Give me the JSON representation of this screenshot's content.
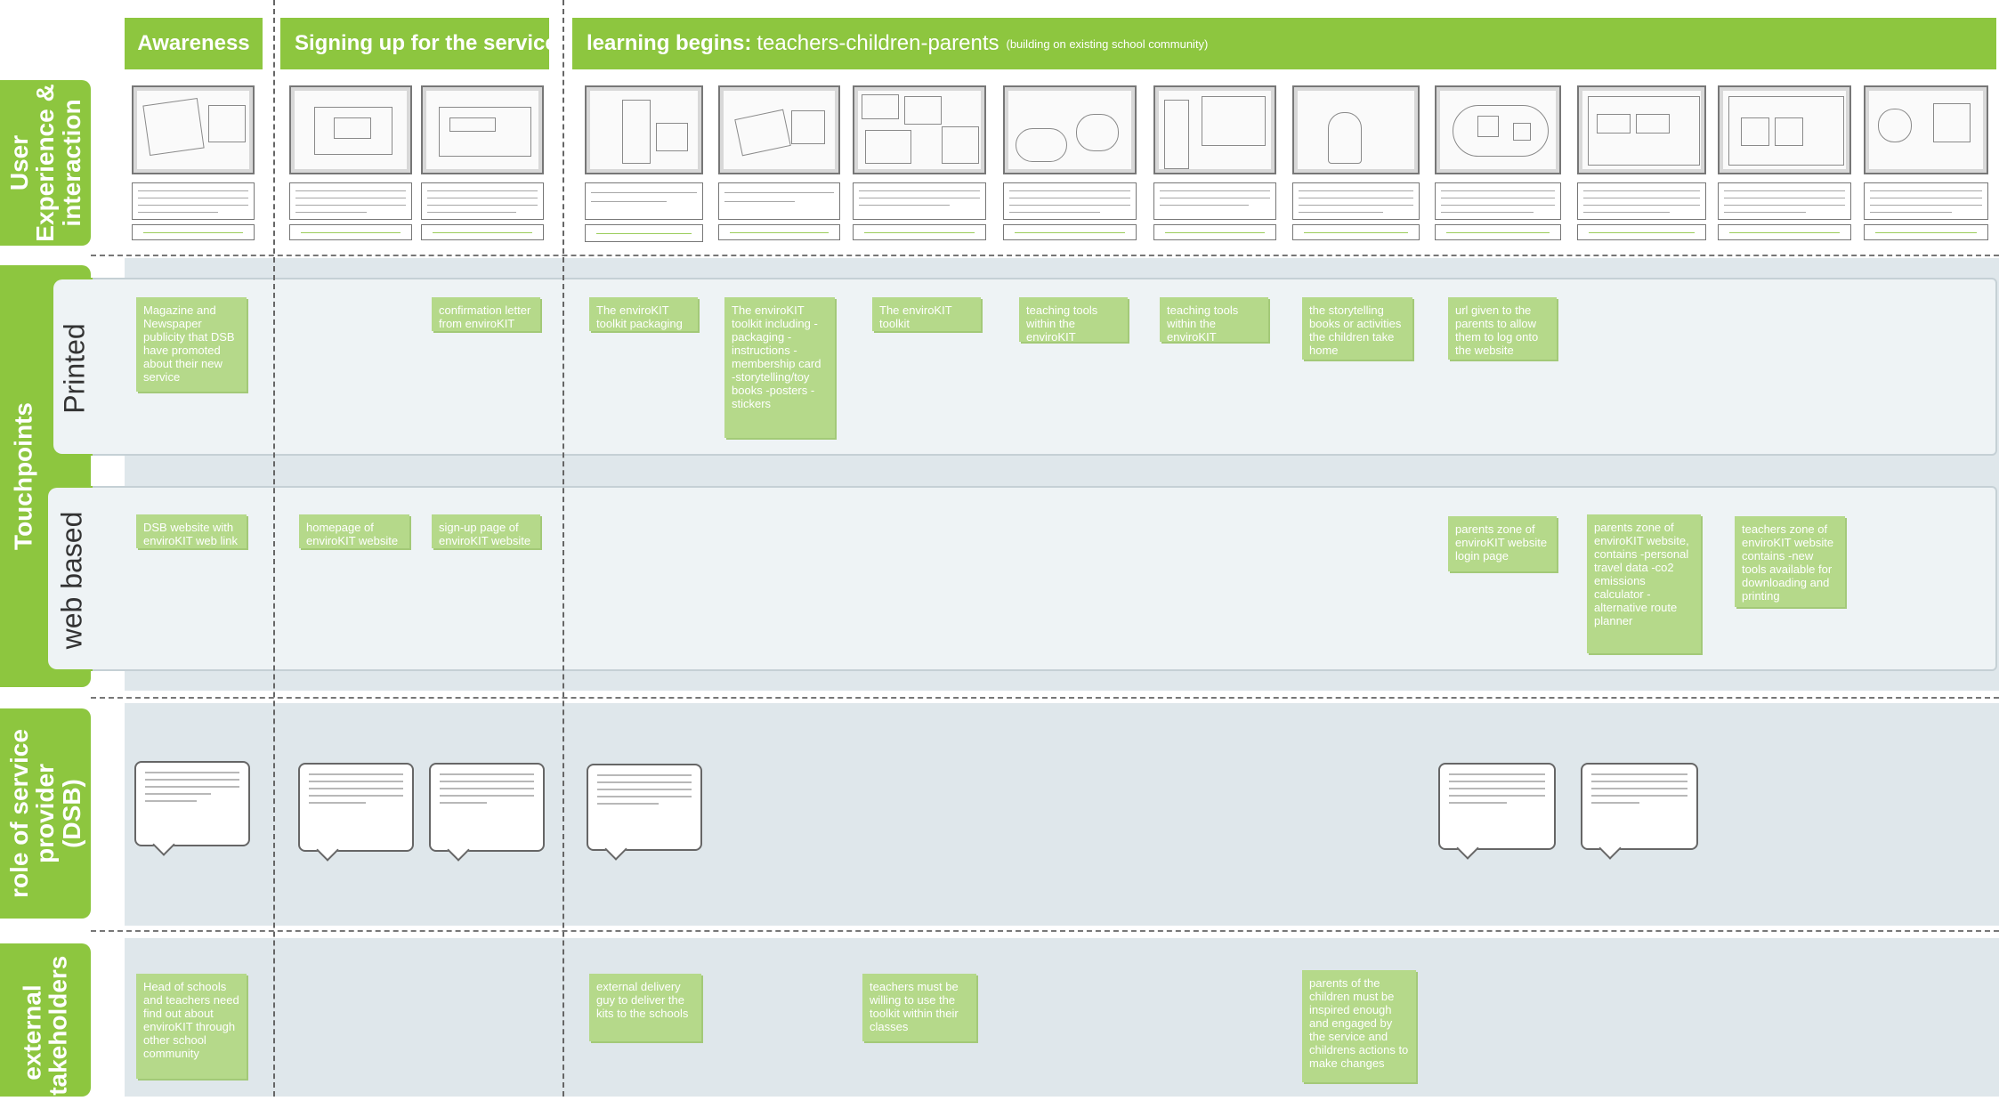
{
  "phases": {
    "awareness": "Awareness",
    "signup": "Signing up for the service",
    "learning_main": "learning begins:",
    "learning_sub": "teachers-children-parents",
    "learning_small": "(building on existing school community)"
  },
  "rows": {
    "user_experience": "User Experience & interaction",
    "touchpoints": "Touchpoints",
    "printed": "Printed",
    "web_based": "web based",
    "role": "role of service provider (DSB)",
    "external": "external stakeholders"
  },
  "printed_notes": [
    "Magazine and Newspaper publicity that DSB have promoted about their new service",
    "confirmation letter from enviroKIT",
    "The enviroKIT toolkit packaging",
    "The enviroKIT toolkit including -packaging -instructions -membership card -storytelling/toy books -posters -stickers",
    "The enviroKIT toolkit",
    "teaching tools within the enviroKIT",
    "teaching tools within the enviroKIT",
    "the storytelling books or activities the children take home",
    "url given to the parents to allow them to log onto the website"
  ],
  "web_notes": [
    "DSB website with enviroKIT web link",
    "homepage of enviroKIT website",
    "sign-up page of enviroKIT website",
    "parents zone of enviroKIT website login page",
    "parents zone of enviroKIT website, contains -personal travel data -co2 emissions calculator -alternative route planner",
    "teachers zone of enviroKIT website contains -new tools available for downloading and printing"
  ],
  "external_notes": [
    "Head of schools and teachers need find out about enviroKIT through other school community",
    "external delivery guy to deliver the kits to the schools",
    "teachers must be willing to use the toolkit within their classes",
    "parents of the children must be inspired enough and engaged by the service and childrens actions to make changes"
  ],
  "colors": {
    "accent": "#8dc63f",
    "note": "#b5d98a",
    "band": "#dfe7eb"
  }
}
